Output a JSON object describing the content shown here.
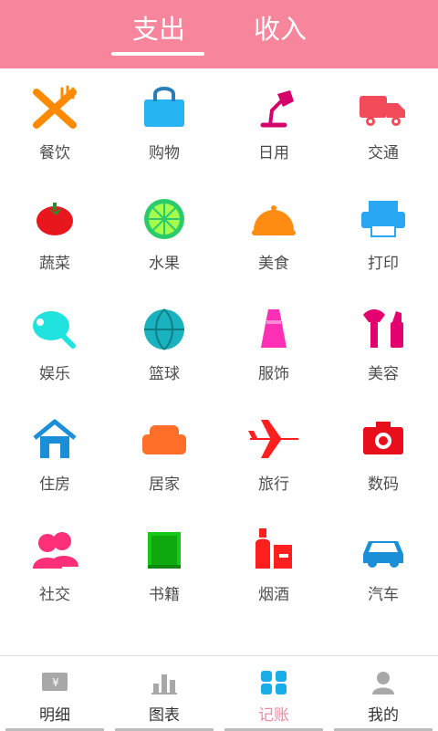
{
  "header": {
    "tab_expense": "支出",
    "tab_income": "收入"
  },
  "categories": [
    {
      "label": "餐饮",
      "icon": "fork-knife-icon"
    },
    {
      "label": "购物",
      "icon": "shopping-bag-icon"
    },
    {
      "label": "日用",
      "icon": "desk-lamp-icon"
    },
    {
      "label": "交通",
      "icon": "truck-icon"
    },
    {
      "label": "蔬菜",
      "icon": "tomato-icon"
    },
    {
      "label": "水果",
      "icon": "lime-icon"
    },
    {
      "label": "美食",
      "icon": "food-cover-icon"
    },
    {
      "label": "打印",
      "icon": "printer-icon"
    },
    {
      "label": "娱乐",
      "icon": "ping-pong-icon"
    },
    {
      "label": "篮球",
      "icon": "basketball-icon"
    },
    {
      "label": "服饰",
      "icon": "dress-icon"
    },
    {
      "label": "美容",
      "icon": "makeup-icon"
    },
    {
      "label": "住房",
      "icon": "house-icon"
    },
    {
      "label": "居家",
      "icon": "sofa-icon"
    },
    {
      "label": "旅行",
      "icon": "airplane-icon"
    },
    {
      "label": "数码",
      "icon": "camera-icon"
    },
    {
      "label": "社交",
      "icon": "people-icon"
    },
    {
      "label": "书籍",
      "icon": "book-icon"
    },
    {
      "label": "烟酒",
      "icon": "bottle-cigarette-icon"
    },
    {
      "label": "汽车",
      "icon": "car-icon"
    }
  ],
  "bottom_nav": [
    {
      "label": "明细",
      "icon": "bill-icon",
      "active": false
    },
    {
      "label": "图表",
      "icon": "bar-chart-icon",
      "active": false
    },
    {
      "label": "记账",
      "icon": "grid-squares-icon",
      "active": true
    },
    {
      "label": "我的",
      "icon": "user-icon",
      "active": false
    }
  ],
  "colors": {
    "header_bg": "#f7869d",
    "active_nav": "#f08aa4"
  }
}
